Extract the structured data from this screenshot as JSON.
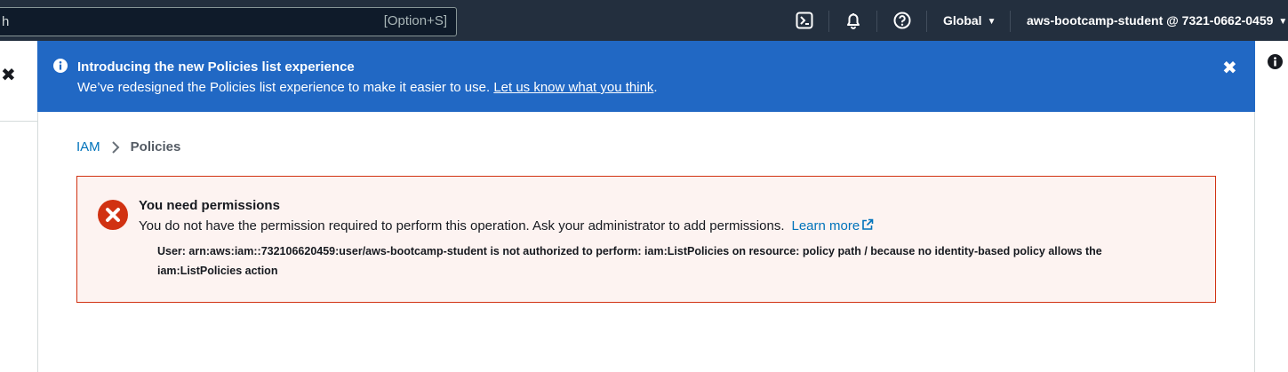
{
  "topbar": {
    "search_value": "h",
    "search_shortcut": "[Option+S]",
    "icons": [
      "cloudshell-icon",
      "bell-icon",
      "help-icon"
    ],
    "region_label": "Global",
    "account_label": "aws-bootcamp-student @ 7321-0662-0459"
  },
  "flash": {
    "title": "Introducing the new Policies list experience",
    "body_text": "We’ve redesigned the Policies list experience to make it easier to use.",
    "link_text": "Let us know what you think",
    "body_suffix": ".",
    "color": "#2168c4"
  },
  "breadcrumb": {
    "root": "IAM",
    "current": "Policies"
  },
  "alert": {
    "title": "You need permissions",
    "message": "You do not have the permission required to perform this operation. Ask your administrator to add permissions.",
    "learn_more": "Learn more",
    "detail": "User: arn:aws:iam::732106620459:user/aws-bootcamp-student is not authorized to perform: iam:ListPolicies on resource: policy path / because no identity-based policy allows the iam:ListPolicies action",
    "color": "#d13212"
  }
}
